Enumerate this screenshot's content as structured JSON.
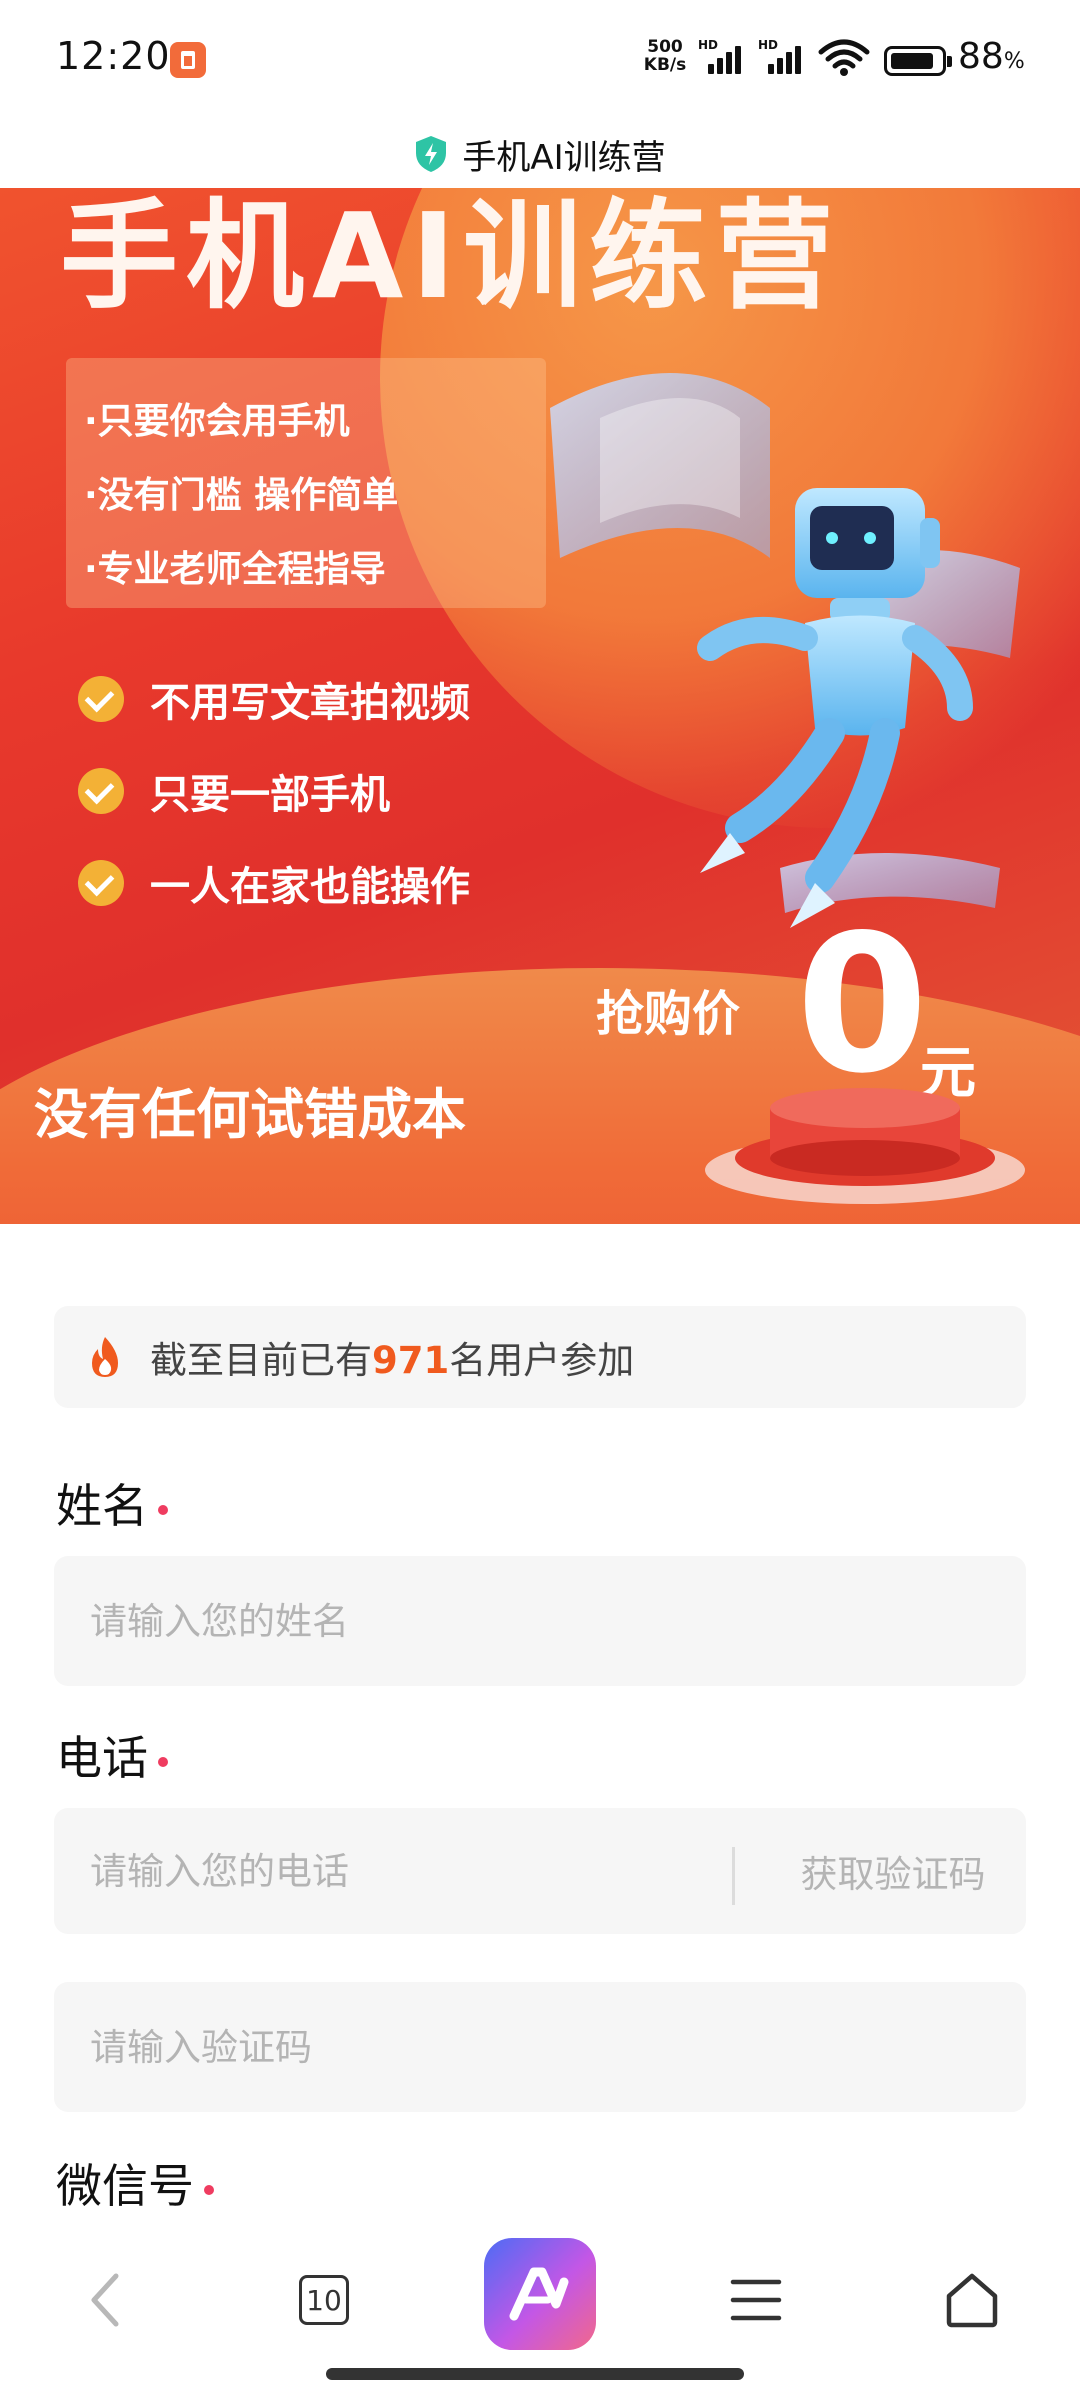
{
  "status_bar": {
    "time": "12:20",
    "net_speed_value": "500",
    "net_speed_unit": "KB/s",
    "sim1_label": "HD",
    "sim2_label": "HD",
    "battery_percent_value": "88",
    "battery_percent_unit": "%",
    "battery_level": 0.88
  },
  "header": {
    "title": "手机AI训练营",
    "icon": "shield-bolt-icon",
    "icon_color": "#2ec4a5"
  },
  "banner": {
    "headline": "手机AI训练营",
    "bullets": [
      "·只要你会用手机",
      "·没有门槛 操作简单",
      "·专业老师全程指导"
    ],
    "checks": [
      "不用写文章拍视频",
      "只要一部手机",
      "一人在家也能操作"
    ],
    "price_label": "抢购价",
    "price_value": "0",
    "price_unit": "元",
    "tagline": "没有任何试错成本",
    "colors": {
      "primary": "#e8392c",
      "accent": "#f3b136"
    }
  },
  "notice": {
    "icon": "flame-icon",
    "prefix": "截至目前已有",
    "count": "971",
    "suffix": "名用户参加",
    "count_color": "#f05a1e"
  },
  "form": {
    "name_label": "姓名",
    "name_placeholder": "请输入您的姓名",
    "phone_label": "电话",
    "phone_placeholder": "请输入您的电话",
    "get_code_label": "获取验证码",
    "code_placeholder": "请输入验证码",
    "wechat_label": "微信号",
    "required_color": "#ef3c60"
  },
  "bottom_nav": {
    "back_icon": "chevron-left-icon",
    "tabs_count": "10",
    "ai_icon": "ai-assistant-icon",
    "menu_icon": "menu-icon",
    "home_icon": "home-icon"
  }
}
